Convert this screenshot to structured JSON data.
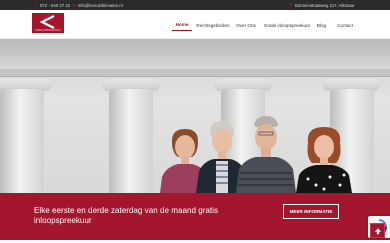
{
  "topbar": {
    "phone": "072 - 540 27 22",
    "email": "info@kenuisbinnaten.nl",
    "address": "Bonnenstraatweg 117, Alkmaar",
    "icons": [
      "phone-icon",
      "mail-icon",
      "location-icon"
    ]
  },
  "header": {
    "logo_subtext": "KENUISBINNATEN",
    "nav": [
      {
        "label": "Home",
        "active": true
      },
      {
        "label": "Rechtsgebieden",
        "active": false
      },
      {
        "label": "Over Ons",
        "active": false
      },
      {
        "label": "Gratis inloopspreekuur",
        "active": false
      },
      {
        "label": "Blog",
        "active": false
      },
      {
        "label": "Contact",
        "active": false
      }
    ]
  },
  "banner": {
    "text": "Elke eerste en derde zaterdag van de maand gratis inloopspreekuur",
    "button_label": "MEER INFORMATIE"
  },
  "colors": {
    "brand": "#a4162e",
    "topbar": "#2b2b2b"
  },
  "floating": {
    "back_to_top_icon": "arrow-up-icon",
    "captcha_icon": "recaptcha-icon"
  }
}
